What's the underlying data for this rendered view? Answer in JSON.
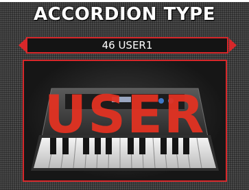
{
  "screen": {
    "title": "ACCORDION TYPE",
    "selected_value": "46 USER1",
    "image_overlay_text": "USER"
  },
  "colors": {
    "accent": "#d8272a",
    "overlay_text": "#e23222",
    "background": "#2a2a2a"
  },
  "icons": {
    "prev": "arrow-left-icon",
    "next": "arrow-right-icon"
  }
}
